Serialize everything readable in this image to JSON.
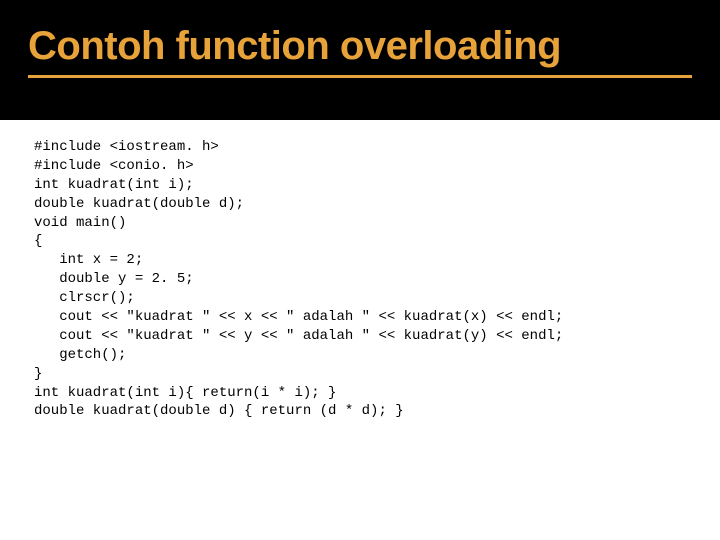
{
  "slide": {
    "title": "Contoh function overloading"
  },
  "code": {
    "l1": "#include <iostream. h>",
    "l2": "#include <conio. h>",
    "l3": "int kuadrat(int i);",
    "l4": "double kuadrat(double d);",
    "l5": "void main()",
    "l6": "{",
    "l7": "   int x = 2;",
    "l8": "   double y = 2. 5;",
    "l9": "   clrscr();",
    "l10": "   cout << \"kuadrat \" << x << \" adalah \" << kuadrat(x) << endl;",
    "l11": "   cout << \"kuadrat \" << y << \" adalah \" << kuadrat(y) << endl;",
    "l12": "   getch();",
    "l13": "}",
    "l14": "int kuadrat(int i){ return(i * i); }",
    "l15": "double kuadrat(double d) { return (d * d); }"
  }
}
